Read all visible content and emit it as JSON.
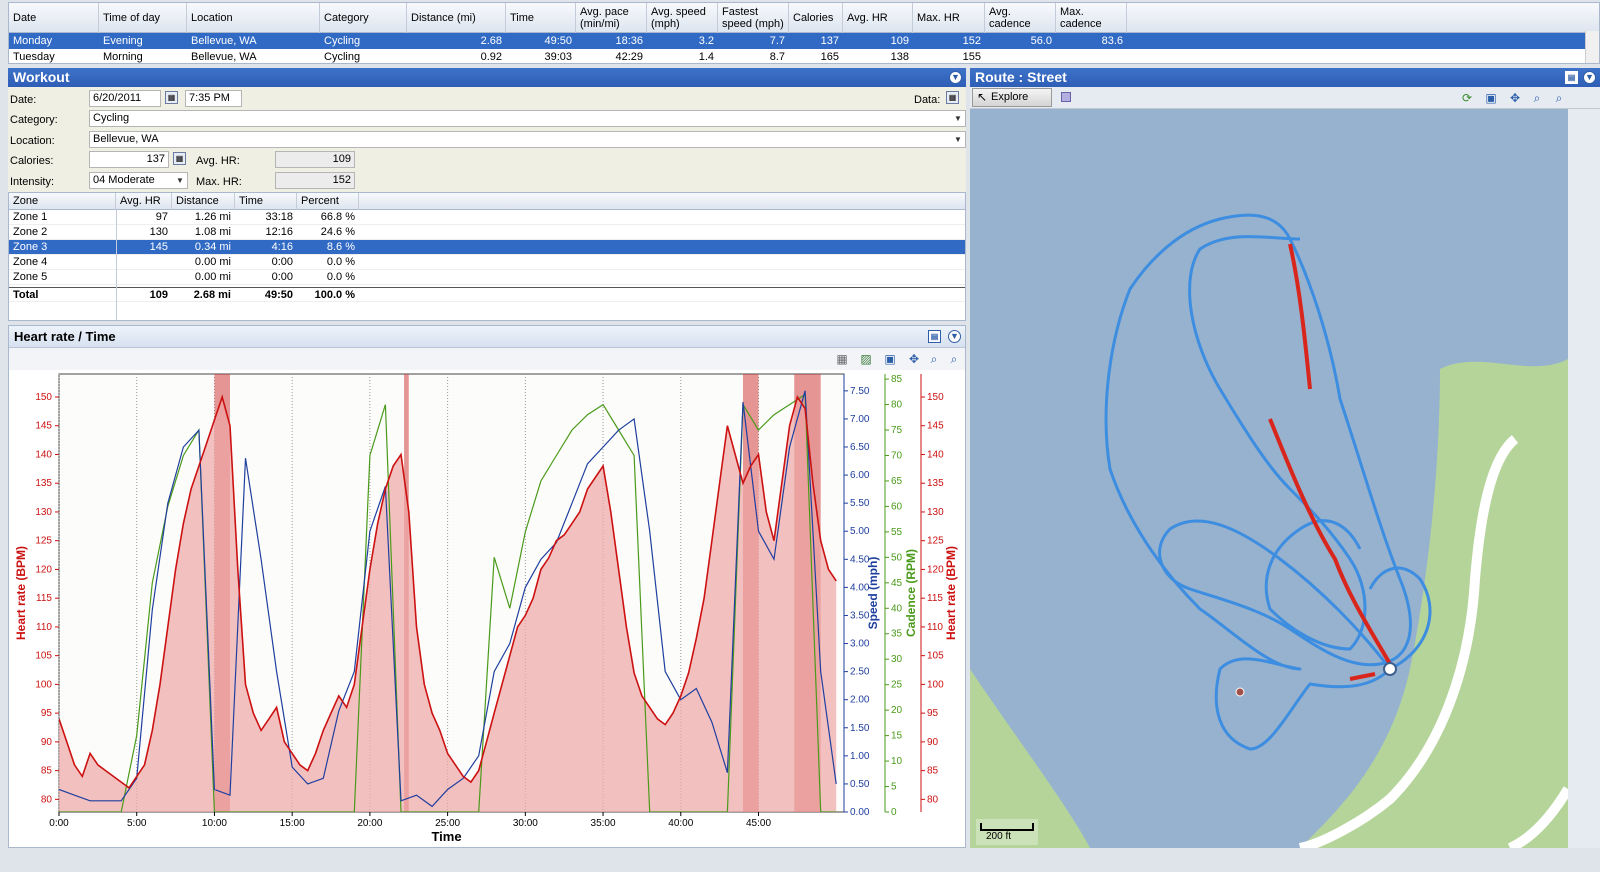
{
  "top_grid": {
    "columns": [
      "Date",
      "Time of day",
      "Location",
      "Category",
      "Distance (mi)",
      "Time",
      "Avg. pace (min/mi)",
      "Avg. speed (mph)",
      "Fastest speed (mph)",
      "Calories",
      "Avg. HR",
      "Max. HR",
      "Avg. cadence",
      "Max. cadence"
    ],
    "rows": [
      {
        "selected": true,
        "cells": [
          "Monday",
          "Evening",
          "Bellevue, WA",
          "Cycling",
          "2.68",
          "49:50",
          "18:36",
          "3.2",
          "7.7",
          "137",
          "109",
          "152",
          "56.0",
          "83.6"
        ]
      },
      {
        "selected": false,
        "cells": [
          "Tuesday",
          "Morning",
          "Bellevue, WA",
          "Cycling",
          "0.92",
          "39:03",
          "42:29",
          "1.4",
          "8.7",
          "165",
          "138",
          "155",
          "",
          ""
        ]
      }
    ]
  },
  "workout": {
    "title": "Workout",
    "date_label": "Date:",
    "date_value": "6/20/2011",
    "time_value": "7:35 PM",
    "data_label": "Data:",
    "category_label": "Category:",
    "category_value": "Cycling",
    "location_label": "Location:",
    "location_value": "Bellevue, WA",
    "calories_label": "Calories:",
    "calories_value": "137",
    "avg_hr_label": "Avg. HR:",
    "avg_hr_value": "109",
    "intensity_label": "Intensity:",
    "intensity_value": "04 Moderate",
    "max_hr_label": "Max. HR:",
    "max_hr_value": "152"
  },
  "zones": {
    "columns": [
      "Zone",
      "Avg. HR",
      "Distance",
      "Time",
      "Percent"
    ],
    "rows": [
      {
        "selected": false,
        "cells": [
          "Zone 1",
          "97",
          "1.26 mi",
          "33:18",
          "66.8 %"
        ]
      },
      {
        "selected": false,
        "cells": [
          "Zone 2",
          "130",
          "1.08 mi",
          "12:16",
          "24.6 %"
        ]
      },
      {
        "selected": true,
        "cells": [
          "Zone 3",
          "145",
          "0.34 mi",
          "4:16",
          "8.6 %"
        ]
      },
      {
        "selected": false,
        "cells": [
          "Zone 4",
          "",
          "0.00 mi",
          "0:00",
          "0.0 %"
        ]
      },
      {
        "selected": false,
        "cells": [
          "Zone 5",
          "",
          "0.00 mi",
          "0:00",
          "0.0 %"
        ]
      }
    ],
    "total": [
      "Total",
      "109",
      "2.68 mi",
      "49:50",
      "100.0 %"
    ]
  },
  "chart_panel": {
    "title": "Heart rate / Time"
  },
  "chart_data": {
    "type": "line",
    "xlabel": "Time",
    "x_ticks": [
      "0:00",
      "5:00",
      "10:00",
      "15:00",
      "20:00",
      "25:00",
      "30:00",
      "35:00",
      "40:00",
      "45:00"
    ],
    "xlim": [
      0,
      50.5
    ],
    "hr_axis": {
      "label": "Heart rate (BPM)",
      "ticks": [
        80,
        85,
        90,
        95,
        100,
        105,
        110,
        115,
        120,
        125,
        130,
        135,
        140,
        145,
        150
      ],
      "ylim": [
        77.8,
        154
      ]
    },
    "speed_axis": {
      "label": "Speed (mph)",
      "ticks": [
        "0.00",
        "0.50",
        "1.00",
        "1.50",
        "2.00",
        "2.50",
        "3.00",
        "3.50",
        "4.00",
        "4.50",
        "5.00",
        "5.50",
        "6.00",
        "6.50",
        "7.00",
        "7.50"
      ],
      "ylim": [
        0,
        7.8
      ]
    },
    "cadence_axis": {
      "label": "Cadence (RPM)",
      "ticks": [
        0,
        5,
        10,
        15,
        20,
        25,
        30,
        35,
        40,
        45,
        50,
        55,
        60,
        65,
        70,
        75,
        80,
        85
      ],
      "ylim": [
        0,
        86
      ]
    },
    "series": [
      {
        "name": "Heart rate (BPM)",
        "color": "#cc1111",
        "x": [
          0,
          0.5,
          1,
          1.5,
          2,
          2.5,
          3,
          3.5,
          4,
          4.5,
          5,
          5.5,
          6,
          6.5,
          7,
          7.5,
          8,
          8.5,
          9,
          9.5,
          10,
          10.5,
          11,
          11.5,
          12,
          12.5,
          13,
          13.5,
          14,
          14.5,
          15,
          15.5,
          16,
          16.5,
          17,
          17.5,
          18,
          18.5,
          19,
          19.5,
          20,
          20.5,
          21,
          21.5,
          22,
          22.5,
          23,
          23.5,
          24,
          24.5,
          25,
          25.5,
          26,
          26.5,
          27,
          27.5,
          28,
          28.5,
          29,
          29.5,
          30,
          30.5,
          31,
          31.5,
          32,
          32.5,
          33,
          33.5,
          34,
          34.5,
          35,
          35.5,
          36,
          36.5,
          37,
          37.5,
          38,
          38.5,
          39,
          39.5,
          40,
          40.5,
          41,
          41.5,
          42,
          42.5,
          43,
          43.5,
          44,
          44.5,
          45,
          45.5,
          46,
          46.5,
          47,
          47.5,
          48,
          48.5,
          49,
          49.5,
          50
        ],
        "y": [
          94,
          90,
          86,
          84,
          88,
          86,
          85,
          84,
          83,
          82,
          84,
          86,
          92,
          100,
          110,
          120,
          128,
          134,
          138,
          142,
          146,
          150,
          145,
          120,
          100,
          95,
          92,
          94,
          96,
          90,
          88,
          86,
          85,
          88,
          92,
          95,
          98,
          96,
          100,
          110,
          120,
          128,
          134,
          138,
          140,
          130,
          110,
          100,
          95,
          92,
          88,
          86,
          84,
          83,
          85,
          90,
          95,
          100,
          105,
          110,
          112,
          115,
          120,
          122,
          125,
          126,
          128,
          130,
          134,
          136,
          138,
          130,
          120,
          110,
          102,
          98,
          96,
          94,
          93,
          95,
          98,
          102,
          108,
          115,
          125,
          135,
          145,
          140,
          135,
          138,
          140,
          130,
          125,
          135,
          145,
          150,
          148,
          135,
          125,
          120,
          118
        ]
      },
      {
        "name": "Speed (mph)",
        "color": "#1f3f9f",
        "x": [
          0,
          1,
          2,
          3,
          4,
          5,
          6,
          7,
          8,
          9,
          10,
          11,
          12,
          13,
          14,
          15,
          16,
          17,
          18,
          19,
          20,
          21,
          22,
          23,
          24,
          25,
          26,
          27,
          28,
          29,
          30,
          31,
          32,
          33,
          34,
          35,
          36,
          37,
          38,
          39,
          40,
          41,
          42,
          43,
          44,
          45,
          46,
          47,
          48,
          49,
          50
        ],
        "y": [
          0.4,
          0.3,
          0.2,
          0.2,
          0.2,
          0.6,
          3.6,
          5.5,
          6.5,
          6.8,
          0.4,
          0.3,
          6.3,
          4.5,
          2.5,
          0.8,
          0.5,
          0.6,
          1.8,
          2.5,
          5.0,
          5.8,
          0.2,
          0.3,
          0.1,
          0.4,
          0.6,
          1.0,
          2.5,
          3.0,
          4.0,
          4.5,
          4.8,
          5.5,
          6.2,
          6.5,
          6.8,
          7.0,
          5.0,
          2.5,
          2.0,
          2.2,
          1.6,
          0.7,
          7.3,
          5.0,
          4.5,
          6.5,
          7.5,
          2.5,
          0.5
        ]
      },
      {
        "name": "Cadence (RPM)",
        "color": "#4a9a1a",
        "x": [
          0,
          1,
          2,
          3,
          4,
          5,
          6,
          7,
          8,
          9,
          10,
          11,
          12,
          13,
          14,
          15,
          16,
          17,
          18,
          19,
          20,
          21,
          22,
          23,
          24,
          25,
          26,
          27,
          28,
          29,
          30,
          31,
          32,
          33,
          34,
          35,
          36,
          37,
          38,
          39,
          40,
          41,
          42,
          43,
          44,
          45,
          46,
          47,
          48,
          49,
          50
        ],
        "y": [
          0,
          0,
          0,
          0,
          0,
          15,
          45,
          60,
          70,
          75,
          0,
          0,
          0,
          0,
          0,
          0,
          0,
          0,
          0,
          0,
          70,
          80,
          0,
          0,
          0,
          0,
          0,
          0,
          50,
          40,
          55,
          65,
          70,
          75,
          78,
          80,
          75,
          70,
          0,
          0,
          0,
          0,
          0,
          0,
          80,
          75,
          78,
          80,
          82,
          0,
          0
        ]
      }
    ],
    "zone_bands": [
      [
        10.0,
        11.0
      ],
      [
        22.2,
        22.5
      ],
      [
        44.0,
        45.0
      ],
      [
        47.3,
        49.0
      ]
    ]
  },
  "route": {
    "title": "Route : Street",
    "explore_label": "Explore",
    "scale_label": "200 ft"
  }
}
